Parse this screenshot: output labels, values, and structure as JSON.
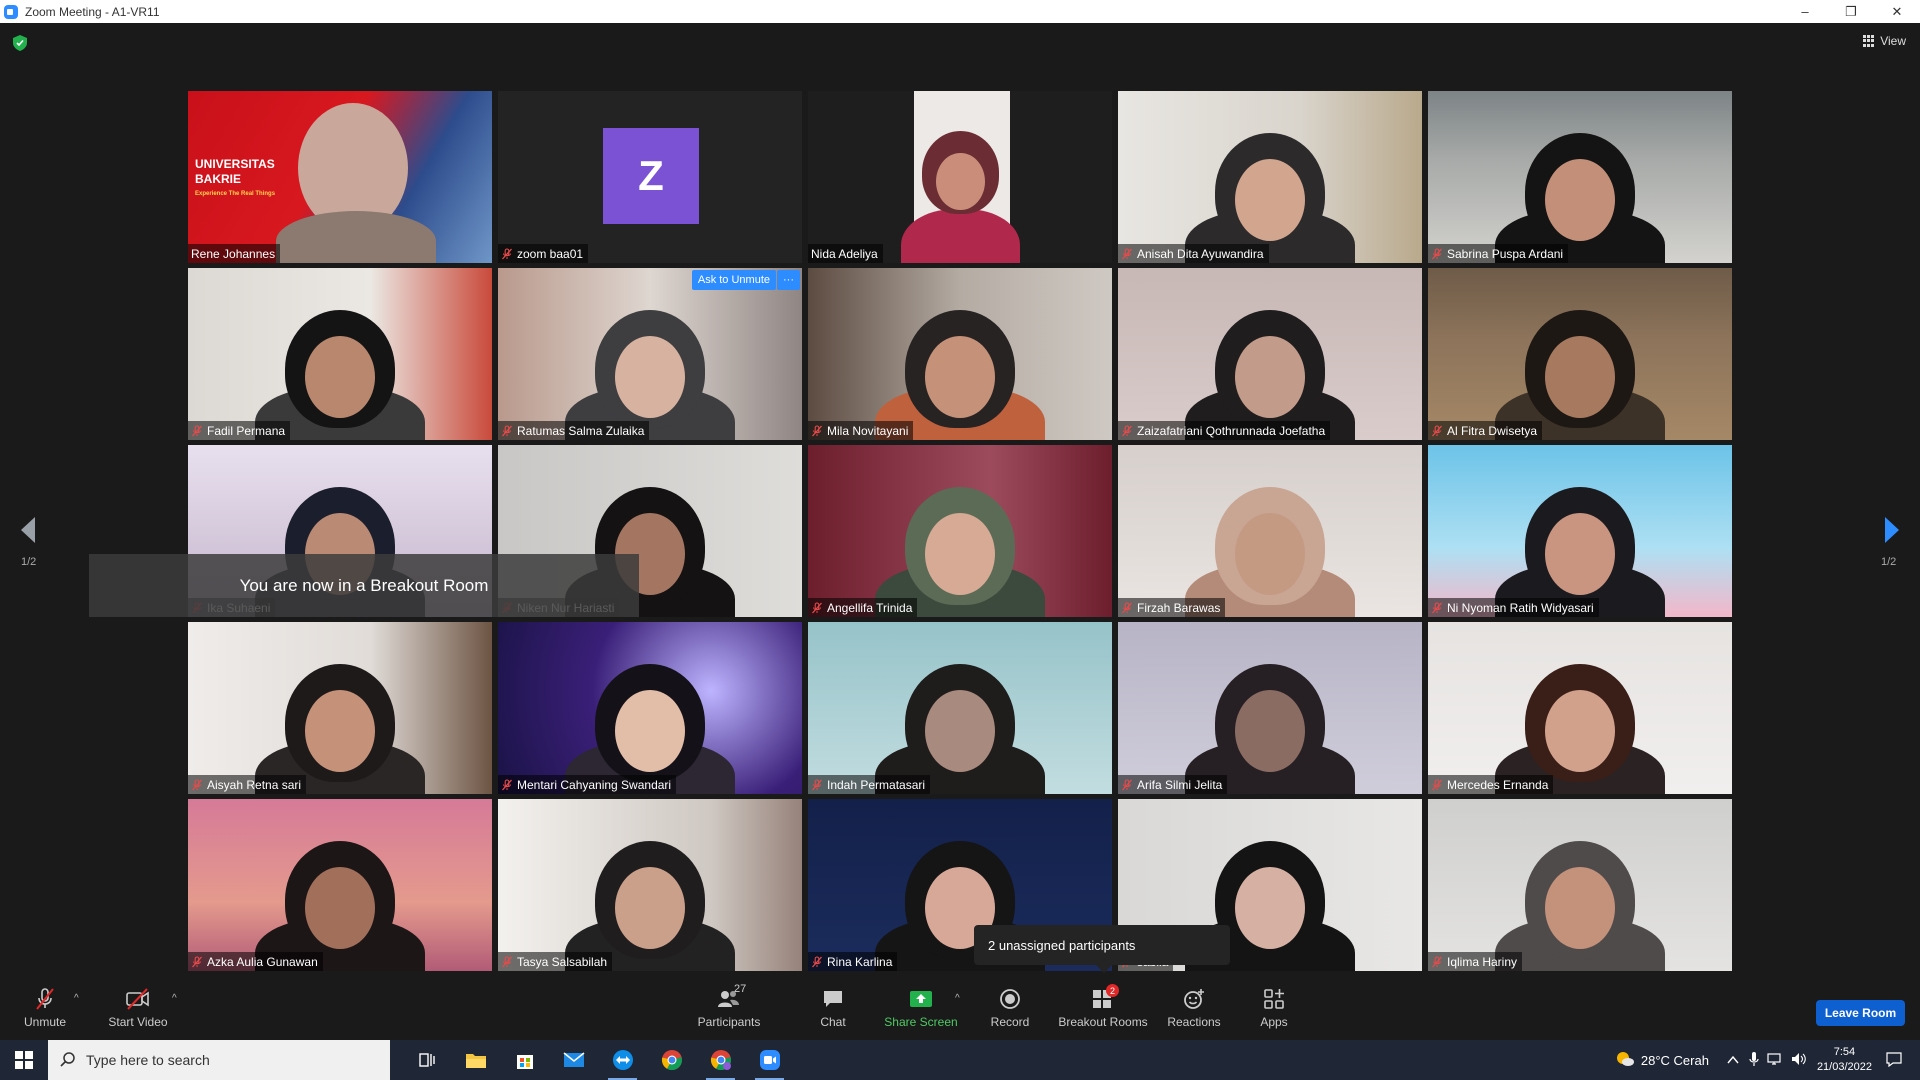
{
  "window": {
    "title": "Zoom Meeting - A1-VR11",
    "minimize": "–",
    "restore": "❐",
    "close": "✕"
  },
  "top": {
    "view_label": "View"
  },
  "grid": {
    "tiles": [
      {
        "name": "Rene Johannes",
        "muted": false
      },
      {
        "name": "zoom baa01",
        "muted": true
      },
      {
        "name": "Nida Adeliya",
        "muted": false
      },
      {
        "name": "Anisah Dita Ayuwandira",
        "muted": true
      },
      {
        "name": "Sabrina Puspa Ardani",
        "muted": true
      },
      {
        "name": "Fadil Permana",
        "muted": true
      },
      {
        "name": "Ratumas Salma Zulaika",
        "muted": true
      },
      {
        "name": "Mila Novitayani",
        "muted": true
      },
      {
        "name": "Zaizafatriani Qothrunnada Joefatha",
        "muted": true
      },
      {
        "name": "Al Fitra Dwisetya",
        "muted": true
      },
      {
        "name": "Ika Suhaeni",
        "muted": true
      },
      {
        "name": "Niken Nur Hariasti",
        "muted": true
      },
      {
        "name": "Angellifa Trinida",
        "muted": true
      },
      {
        "name": "Firzah Barawas",
        "muted": true
      },
      {
        "name": "Ni Nyoman Ratih Widyasari",
        "muted": true
      },
      {
        "name": "Aisyah Retna sari",
        "muted": true
      },
      {
        "name": "Mentari Cahyaning Swandari",
        "muted": true
      },
      {
        "name": "Indah Permatasari",
        "muted": true
      },
      {
        "name": "Arifa Silmi Jelita",
        "muted": true
      },
      {
        "name": "Mercedes Ernanda",
        "muted": true
      },
      {
        "name": "Azka Aulia Gunawan",
        "muted": true
      },
      {
        "name": "Tasya Salsabilah",
        "muted": true
      },
      {
        "name": "Rina Karlina",
        "muted": true
      },
      {
        "name": "sabila",
        "muted": true
      },
      {
        "name": "Iqlima Hariny",
        "muted": true
      }
    ],
    "avatar_letter": "Z",
    "university_banner": {
      "line1": "UNIVERSITAS",
      "line2": "BAKRIE",
      "tagline": "Experience The Real Things"
    },
    "ask_to_unmute": "Ask to Unmute",
    "more": "···"
  },
  "overlays": {
    "breakout_message": "You are now in a Breakout Room",
    "unassigned": "2 unassigned participants"
  },
  "paging": {
    "left_label": "1/2",
    "right_label": "1/2"
  },
  "toolbar": {
    "unmute": "Unmute",
    "start_video": "Start Video",
    "participants": "Participants",
    "participants_count": "27",
    "chat": "Chat",
    "share_screen": "Share Screen",
    "record": "Record",
    "breakout_rooms": "Breakout Rooms",
    "breakout_badge": "2",
    "reactions": "Reactions",
    "apps": "Apps",
    "leave_room": "Leave Room"
  },
  "taskbar": {
    "search_placeholder": "Type here to search",
    "weather": "28°C  Cerah",
    "time": "7:54",
    "date": "21/03/2022"
  },
  "colors": {
    "accent": "#2d8cff",
    "active_speaker": "#e4e16a",
    "share_green": "#4fc965",
    "leave_blue": "#0e5fd0"
  }
}
